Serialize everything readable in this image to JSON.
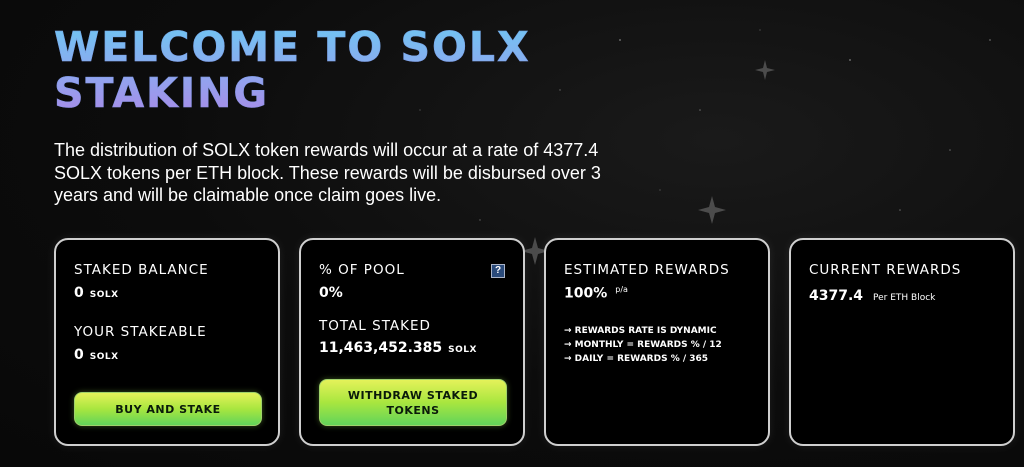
{
  "page": {
    "title_line1": "WELCOME TO SOLX",
    "title_line2": "STAKING",
    "intro": "The distribution of SOLX token rewards will occur at a rate of 4377.4 SOLX tokens per ETH block. These rewards will be disbursed over 3 years and will be claimable once claim goes live."
  },
  "cards": {
    "balance": {
      "staked_label": "STAKED BALANCE",
      "staked_value": "0",
      "staked_unit": "SOLX",
      "stakeable_label": "YOUR STAKEABLE",
      "stakeable_value": "0",
      "stakeable_unit": "SOLX",
      "button_label": "BUY AND STAKE"
    },
    "pool": {
      "pct_label": "% OF POOL",
      "pct_value": "0%",
      "help_icon": "?",
      "total_label": "TOTAL STAKED",
      "total_value": "11,463,452.385",
      "total_unit": "SOLX",
      "button_label": "WITHDRAW STAKED TOKENS"
    },
    "estimated": {
      "label": "ESTIMATED REWARDS",
      "value": "100%",
      "suffix": "p/a",
      "notes": [
        "→ REWARDS RATE IS DYNAMIC",
        "→ MONTHLY = REWARDS % / 12",
        "→ DAILY = REWARDS % / 365"
      ]
    },
    "current": {
      "label": "CURRENT REWARDS",
      "value": "4377.4",
      "suffix": "Per ETH Block"
    }
  },
  "colors": {
    "background": "#0c0c0c",
    "card_border": "#cfcfcf",
    "title_gradient_top": "#6fc6f2",
    "title_gradient_bottom": "#a98be8",
    "button_gradient_top": "#e4f25a",
    "button_gradient_bottom": "#62d45a"
  },
  "icons": {
    "help": "question-help-icon",
    "sparkles": "star-sparkle-icon"
  }
}
